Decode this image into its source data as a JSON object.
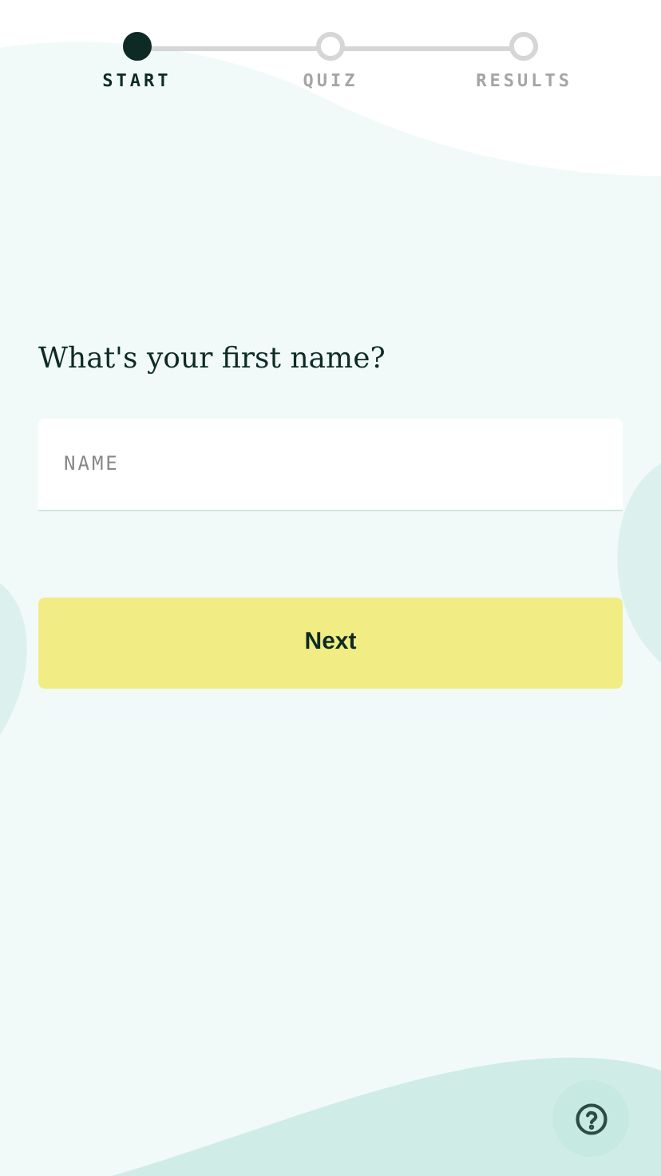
{
  "steps": [
    {
      "label": "START",
      "selected": true
    },
    {
      "label": "QUIZ",
      "selected": false
    },
    {
      "label": "RESULTS",
      "selected": false
    }
  ],
  "question": "What's your first name?",
  "name_field": {
    "placeholder": "NAME"
  },
  "next_button": "Next",
  "help_button": {
    "kind": "help"
  }
}
